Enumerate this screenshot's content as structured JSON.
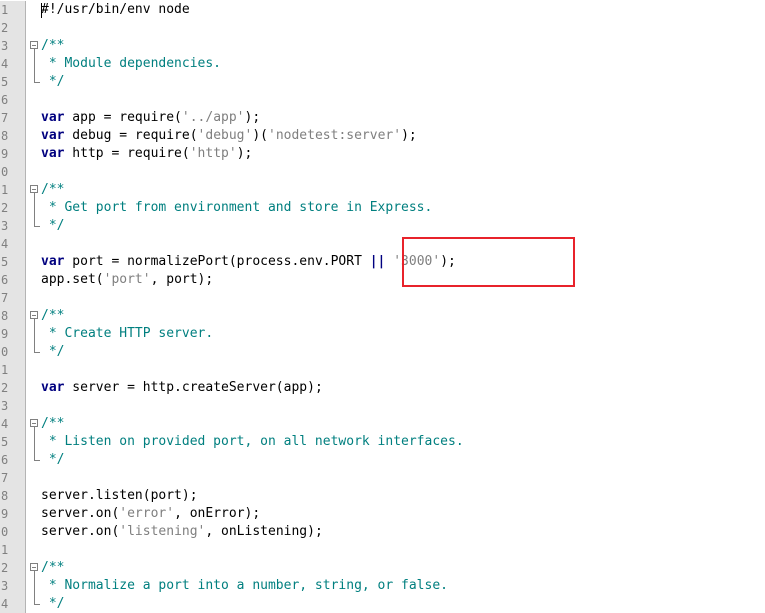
{
  "editor": {
    "lines": [
      {
        "num": "1",
        "tokens": [
          {
            "c": "plain",
            "t": "#!/usr/bin/env node"
          }
        ]
      },
      {
        "num": "2",
        "tokens": []
      },
      {
        "num": "3",
        "fold": "start",
        "tokens": [
          {
            "c": "cm",
            "t": "/**"
          }
        ]
      },
      {
        "num": "4",
        "fold": "mid",
        "tokens": [
          {
            "c": "cm",
            "t": " * Module dependencies."
          }
        ]
      },
      {
        "num": "5",
        "fold": "end",
        "tokens": [
          {
            "c": "cm",
            "t": " */"
          }
        ]
      },
      {
        "num": "6",
        "tokens": []
      },
      {
        "num": "7",
        "tokens": [
          {
            "c": "kw",
            "t": "var"
          },
          {
            "c": "plain",
            "t": " app = require("
          },
          {
            "c": "str",
            "t": "'../app'"
          },
          {
            "c": "plain",
            "t": ");"
          }
        ]
      },
      {
        "num": "8",
        "tokens": [
          {
            "c": "kw",
            "t": "var"
          },
          {
            "c": "plain",
            "t": " debug = require("
          },
          {
            "c": "str",
            "t": "'debug'"
          },
          {
            "c": "plain",
            "t": ")("
          },
          {
            "c": "str",
            "t": "'nodetest:server'"
          },
          {
            "c": "plain",
            "t": ");"
          }
        ]
      },
      {
        "num": "9",
        "tokens": [
          {
            "c": "kw",
            "t": "var"
          },
          {
            "c": "plain",
            "t": " http = require("
          },
          {
            "c": "str",
            "t": "'http'"
          },
          {
            "c": "plain",
            "t": ");"
          }
        ]
      },
      {
        "num": "0",
        "tokens": []
      },
      {
        "num": "1",
        "fold": "start",
        "tokens": [
          {
            "c": "cm",
            "t": "/**"
          }
        ]
      },
      {
        "num": "2",
        "fold": "mid",
        "tokens": [
          {
            "c": "cm",
            "t": " * Get port from environment and store in Express."
          }
        ]
      },
      {
        "num": "3",
        "fold": "end",
        "tokens": [
          {
            "c": "cm",
            "t": " */"
          }
        ]
      },
      {
        "num": "4",
        "tokens": []
      },
      {
        "num": "5",
        "tokens": [
          {
            "c": "kw",
            "t": "var"
          },
          {
            "c": "plain",
            "t": " port = normalizePort(process.env.PORT "
          },
          {
            "c": "op",
            "t": "||"
          },
          {
            "c": "plain",
            "t": " "
          },
          {
            "c": "str",
            "t": "'3000'"
          },
          {
            "c": "plain",
            "t": ");"
          }
        ]
      },
      {
        "num": "6",
        "tokens": [
          {
            "c": "plain",
            "t": "app.set("
          },
          {
            "c": "str",
            "t": "'port'"
          },
          {
            "c": "plain",
            "t": ", port);"
          }
        ]
      },
      {
        "num": "7",
        "tokens": []
      },
      {
        "num": "8",
        "fold": "start",
        "tokens": [
          {
            "c": "cm",
            "t": "/**"
          }
        ]
      },
      {
        "num": "9",
        "fold": "mid",
        "tokens": [
          {
            "c": "cm",
            "t": " * Create HTTP server."
          }
        ]
      },
      {
        "num": "0",
        "fold": "end",
        "tokens": [
          {
            "c": "cm",
            "t": " */"
          }
        ]
      },
      {
        "num": "1",
        "tokens": []
      },
      {
        "num": "2",
        "tokens": [
          {
            "c": "kw",
            "t": "var"
          },
          {
            "c": "plain",
            "t": " server = http.createServer(app);"
          }
        ]
      },
      {
        "num": "3",
        "tokens": []
      },
      {
        "num": "4",
        "fold": "start",
        "tokens": [
          {
            "c": "cm",
            "t": "/**"
          }
        ]
      },
      {
        "num": "5",
        "fold": "mid",
        "tokens": [
          {
            "c": "cm",
            "t": " * Listen on provided port, on all network interfaces."
          }
        ]
      },
      {
        "num": "6",
        "fold": "end",
        "tokens": [
          {
            "c": "cm",
            "t": " */"
          }
        ]
      },
      {
        "num": "7",
        "tokens": []
      },
      {
        "num": "8",
        "tokens": [
          {
            "c": "plain",
            "t": "server.listen(port);"
          }
        ]
      },
      {
        "num": "9",
        "tokens": [
          {
            "c": "plain",
            "t": "server.on("
          },
          {
            "c": "str",
            "t": "'error'"
          },
          {
            "c": "plain",
            "t": ", onError);"
          }
        ]
      },
      {
        "num": "0",
        "tokens": [
          {
            "c": "plain",
            "t": "server.on("
          },
          {
            "c": "str",
            "t": "'listening'"
          },
          {
            "c": "plain",
            "t": ", onListening);"
          }
        ]
      },
      {
        "num": "1",
        "tokens": []
      },
      {
        "num": "2",
        "fold": "start",
        "tokens": [
          {
            "c": "cm",
            "t": "/**"
          }
        ]
      },
      {
        "num": "3",
        "fold": "mid",
        "tokens": [
          {
            "c": "cm",
            "t": " * Normalize a port into a number, string, or false."
          }
        ]
      },
      {
        "num": "4",
        "fold": "end",
        "tokens": [
          {
            "c": "cm",
            "t": " */"
          }
        ]
      }
    ]
  },
  "annotation": {
    "color": "#e8232b"
  }
}
